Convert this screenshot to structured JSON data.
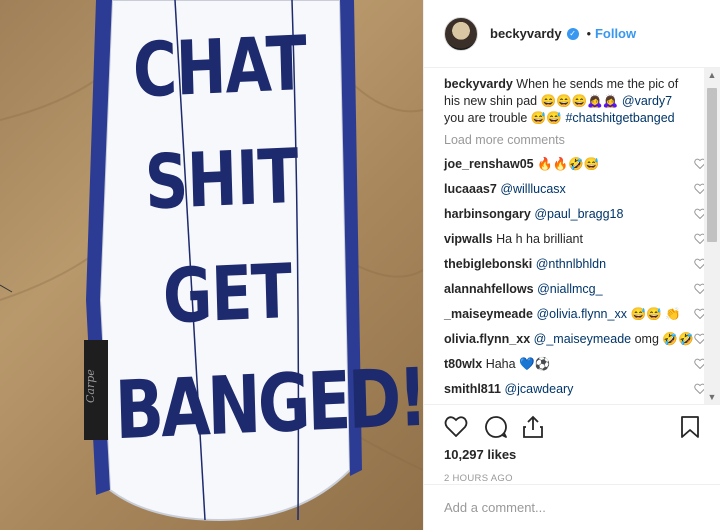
{
  "photo": {
    "pad_lines": [
      "CHAT",
      "SHIT",
      "GET",
      "BANGED!"
    ],
    "brand_tag": "Carpe"
  },
  "header": {
    "username": "beckyvardy",
    "separator": "•",
    "follow_label": "Follow"
  },
  "caption": {
    "username": "beckyvardy",
    "text_1": "When he sends me the pic of his new shin pad 😄😄😄🙇‍♀️🙇‍♀️",
    "mention": "@vardy7",
    "text_2": "you are trouble 😅😅",
    "hashtag": "#chatshitgetbanged"
  },
  "load_more_label": "Load more comments",
  "comments": [
    {
      "user": "joe_renshaw05",
      "pre": "🔥🔥🤣😅",
      "mention": "",
      "post": ""
    },
    {
      "user": "lucaaas7",
      "pre": "",
      "mention": "@willlucasx",
      "post": ""
    },
    {
      "user": "harbinsongary",
      "pre": "",
      "mention": "@paul_bragg18",
      "post": ""
    },
    {
      "user": "vipwalls",
      "pre": "Ha h ha brilliant",
      "mention": "",
      "post": ""
    },
    {
      "user": "thebiglebonski",
      "pre": "",
      "mention": "@nthnlbhldn",
      "post": ""
    },
    {
      "user": "alannahfellows",
      "pre": "",
      "mention": "@niallmcg_",
      "post": ""
    },
    {
      "user": "_maiseymeade",
      "pre": "",
      "mention": "@olivia.flynn_xx",
      "post": "😅😅 👏"
    },
    {
      "user": "olivia.flynn_xx",
      "pre": "",
      "mention": "@_maiseymeade",
      "post": "omg 🤣🤣"
    },
    {
      "user": "t80wlx",
      "pre": "Haha 💙⚽",
      "mention": "",
      "post": ""
    },
    {
      "user": "smithl811",
      "pre": "",
      "mention": "@jcawdeary",
      "post": ""
    }
  ],
  "likes": "10,297 likes",
  "timestamp": "2 HOURS AGO",
  "add_comment_placeholder": "Add a comment...",
  "icons": [
    "heart-icon",
    "comment-icon",
    "share-icon",
    "bookmark-icon",
    "verified-icon"
  ],
  "colors": {
    "link": "#003569",
    "follow": "#3897f0",
    "pad_text": "#1d2a6e"
  }
}
